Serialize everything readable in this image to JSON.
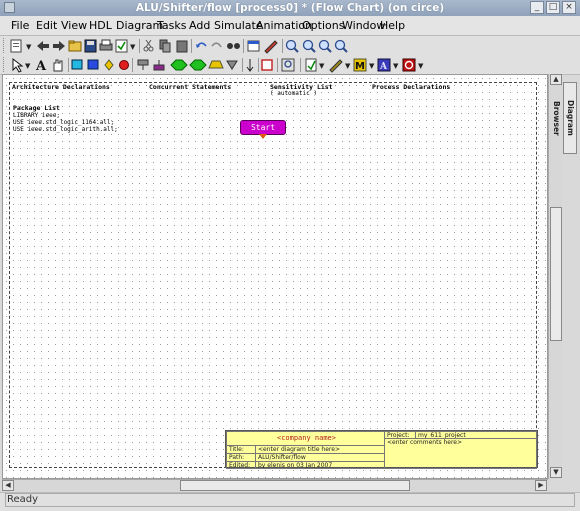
{
  "window": {
    "title": "ALU/Shifter/flow [process0] * (Flow Chart) (on circe)"
  },
  "menubar": {
    "items": [
      "File",
      "Edit",
      "View",
      "HDL",
      "Diagram",
      "Tasks",
      "Add",
      "Simulate",
      "Animation",
      "Options",
      "Window",
      "Help"
    ]
  },
  "canvas": {
    "headers": {
      "architecture": "Architecture Declarations",
      "concurrent": "Concurrent Statements",
      "sensitivity": "Sensitivity List",
      "process": "Process Declarations"
    },
    "sensitivity_value": "( automatic )",
    "package_list": {
      "title": "Package List",
      "lines": [
        "LIBRARY ieee;",
        "USE ieee.std_logic_1164.all;",
        "USE ieee.std_logic_arith.all;"
      ]
    },
    "start_label": "Start"
  },
  "title_block": {
    "company": "<company name>",
    "title_label": "Title:",
    "title_value": "<enter diagram title here>",
    "path_label": "Path:",
    "path_value": "ALU/Shifter/flow",
    "edited_label": "Edited:",
    "edited_value": "by elenis on 03 Jan 2007",
    "project_label": "Project:",
    "project_value": "my_611_project",
    "comments": "<enter comments here>"
  },
  "side_tab": {
    "label": "Diagram Browser"
  },
  "status": {
    "text": "Ready"
  },
  "icons": {
    "toolbar1": [
      "new-icon",
      "open-back-icon",
      "arrow-left-icon",
      "arrow-right-icon",
      "open-folder-icon",
      "save-icon",
      "print-icon",
      "check-icon",
      "cut-icon",
      "copy-icon",
      "paste-icon",
      "undo-icon",
      "redo-icon",
      "find-icon",
      "new-window-icon",
      "edit-icon",
      "zoom-in-icon",
      "zoom-out-icon",
      "zoom-fit-icon",
      "zoom-area-icon"
    ],
    "toolbar2": [
      "select-icon",
      "text-icon",
      "pan-icon",
      "action-box-icon",
      "state-icon",
      "loop-icon",
      "stop-icon",
      "start-point-icon",
      "end-point-icon",
      "decision-icon",
      "wait-icon",
      "case-icon",
      "down-arrow-icon",
      "rectangle-icon",
      "search-icon",
      "check-diagram-icon",
      "color-icon",
      "bold-m-icon",
      "font-icon",
      "no-entry-icon"
    ]
  }
}
